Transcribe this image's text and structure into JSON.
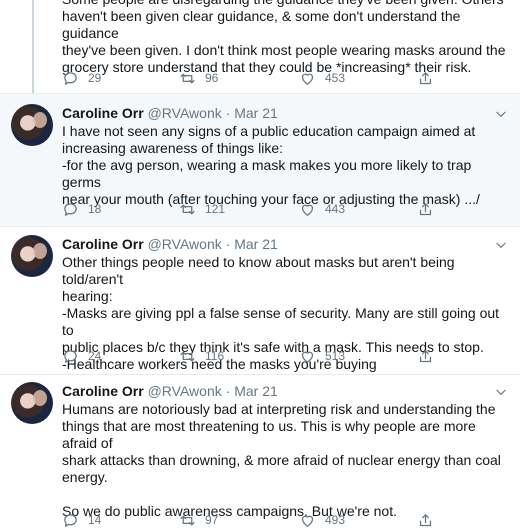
{
  "tweets": [
    {
      "name": "",
      "handle": "",
      "date": "",
      "text": "Some people are disregarding the guidance they've been given. Others\nhaven't been given clear guidance, & some don't understand the guidance\nthey've been given. I don't think most people wearing masks around the\ngrocery store understand that they could be *increasing* their risk.",
      "replies": "29",
      "retweets": "96",
      "likes": "453"
    },
    {
      "name": "Caroline Orr",
      "handle": "@RVAwonk",
      "date": "Mar 21",
      "text": "I have not seen any signs of a public education campaign aimed at\nincreasing awareness of things like:\n-for the avg person, wearing a mask makes you more likely to trap germs\nnear your mouth (after touching your face or adjusting the mask) .../",
      "replies": "18",
      "retweets": "121",
      "likes": "443"
    },
    {
      "name": "Caroline Orr",
      "handle": "@RVAwonk",
      "date": "Mar 21",
      "text": "Other things people need to know about masks but aren't being told/aren't\nhearing:\n-Masks are giving ppl a false sense of security. Many are still going out to\npublic places b/c they think it's safe with a mask. This needs to stop.\n-Healthcare workers need the masks you're buying",
      "replies": "24",
      "retweets": "116",
      "likes": "513"
    },
    {
      "name": "Caroline Orr",
      "handle": "@RVAwonk",
      "date": "Mar 21",
      "text": "Humans are notoriously bad at interpreting risk and understanding the\nthings that are most threatening to us. This is why people are more afraid of\nshark attacks than drowning, & more afraid of nuclear energy than coal\nenergy.\n\nSo we do public awareness campaigns. But we're not.",
      "replies": "14",
      "retweets": "97",
      "likes": "493"
    }
  ],
  "colors": {
    "text": "#14171a",
    "muted": "#657786",
    "highlight_bg": "#f5f8fa",
    "divider": "#e6ecf0"
  },
  "icons": [
    "reply-icon",
    "retweet-icon",
    "like-icon",
    "share-icon",
    "caret-down-icon"
  ]
}
